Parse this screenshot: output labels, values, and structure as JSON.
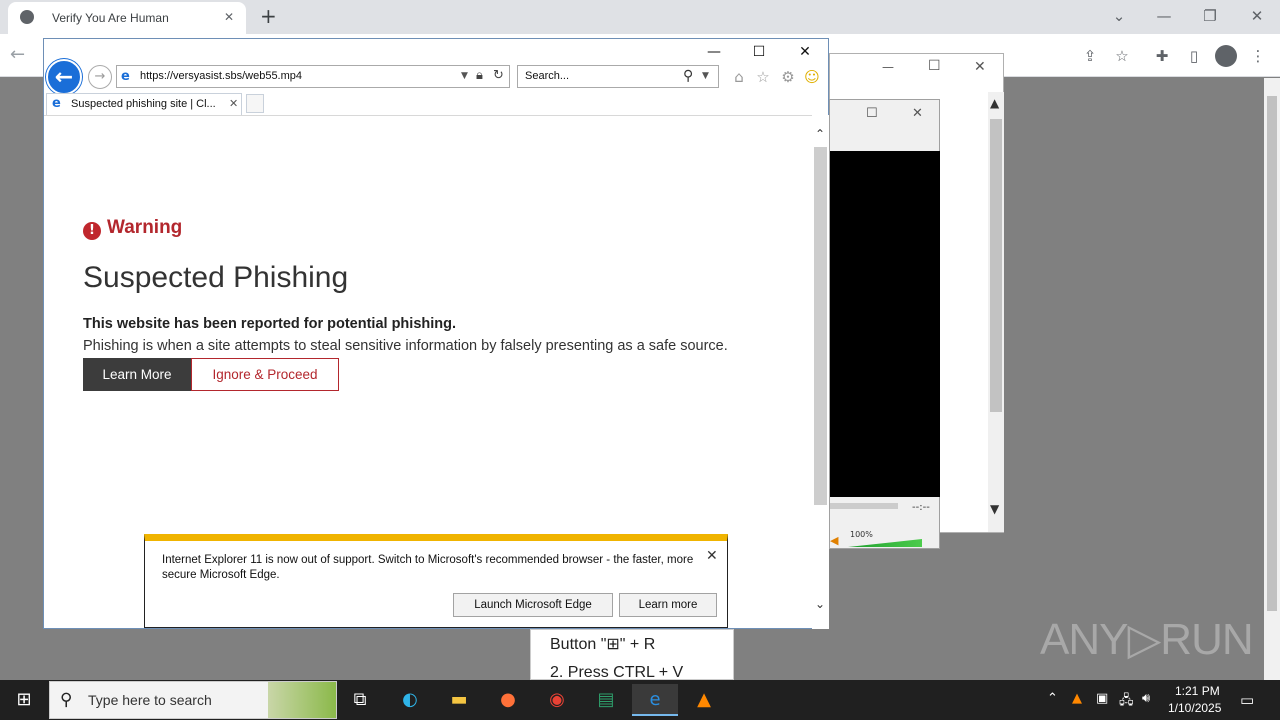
{
  "chrome": {
    "tab_title": "Verify You Are Human",
    "tab_close": "✕",
    "new_tab": "+",
    "dropdown": "⌄",
    "minimize": "—",
    "restore": "❐",
    "close": "✕"
  },
  "win2": {
    "minimize": "—",
    "maximize": "☐",
    "close": "✕"
  },
  "player": {
    "maximize": "☐",
    "close": "✕",
    "time": "--:--",
    "volume_label": "100%",
    "volume_level": 1.0
  },
  "ie": {
    "url": "https://versyasist.sbs/web55.mp4",
    "search_placeholder": "Search...",
    "tab_title": "Suspected phishing site | Cl...",
    "minimize": "—",
    "maximize": "☐",
    "close": "✕"
  },
  "page": {
    "warning_label": "Warning",
    "title": "Suspected Phishing",
    "bold_text": "This website has been reported for potential phishing.",
    "description": "Phishing is when a site attempts to steal sensitive information by falsely presenting as a safe source.",
    "learn_more": "Learn More",
    "ignore_proceed": "Ignore & Proceed"
  },
  "notification": {
    "text": "Internet Explorer 11 is now out of support. Switch to Microsoft's recommended browser - the faster, more secure Microsoft Edge.",
    "launch_edge": "Launch Microsoft Edge",
    "learn_more": "Learn more",
    "close": "✕"
  },
  "note": {
    "line1": "Button \"⊞\" + R",
    "line2": "2. Press CTRL + V"
  },
  "watermark": "ANY▷RUN",
  "taskbar": {
    "search_placeholder": "Type here to search",
    "time": "1:21 PM",
    "date": "1/10/2025"
  },
  "colors": {
    "warning_red": "#b3272d",
    "ie_blue": "#1a6ed8",
    "notify_accent": "#f0b400",
    "taskbar": "#202020"
  }
}
